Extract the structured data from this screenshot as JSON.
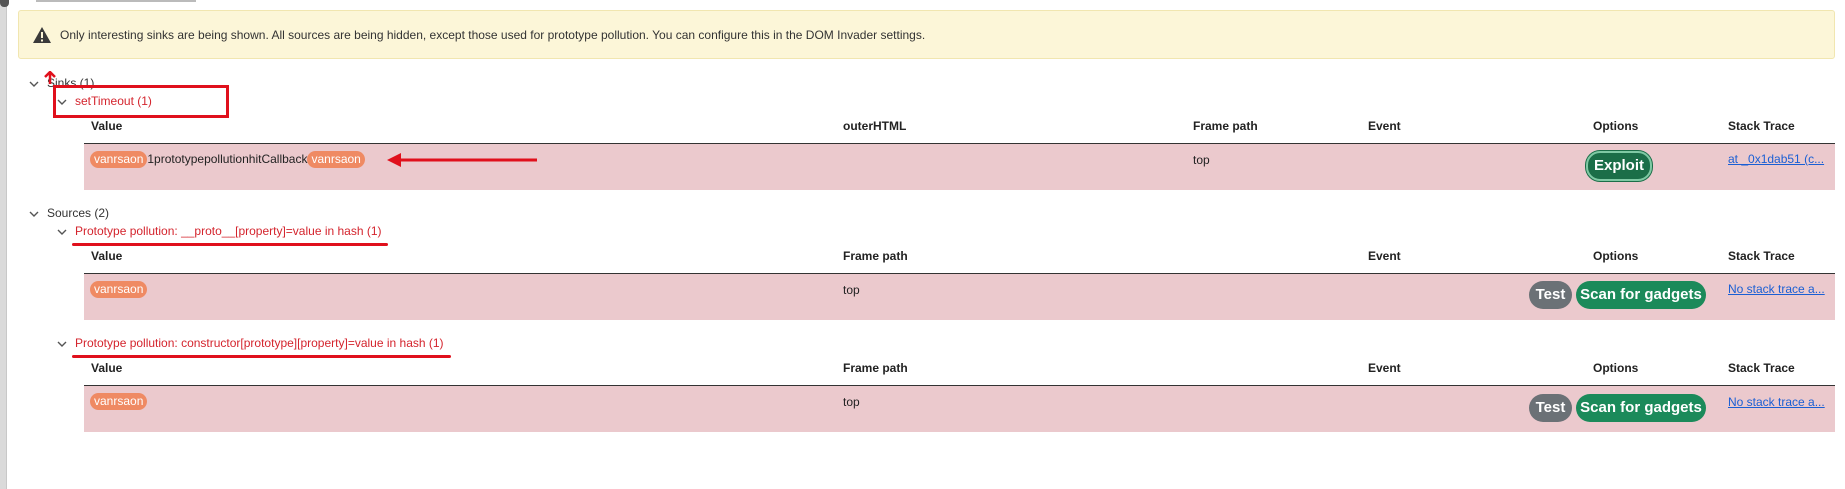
{
  "notice": {
    "text": "Only interesting sinks are being shown. All sources are being hidden, except those used for prototype pollution. You can configure this in the DOM Invader settings."
  },
  "sinks": {
    "label": "Sinks (1)",
    "groups": [
      {
        "label": "setTimeout (1)",
        "columns": {
          "value": "Value",
          "outer": "outerHTML",
          "frame": "Frame path",
          "event": "Event",
          "options": "Options",
          "stack": "Stack Trace"
        },
        "row": {
          "value_tag1": "vanrsaon",
          "value_text": "1prototypepollutionhitCallback",
          "value_tag2": "vanrsaon",
          "frame": "top",
          "exploit_label": "Exploit",
          "stack": "at _0x1dab51 (c..."
        }
      }
    ]
  },
  "sources": {
    "label": "Sources (2)",
    "groups": [
      {
        "label": "Prototype pollution: __proto__[property]=value in hash (1)",
        "columns": {
          "value": "Value",
          "frame": "Frame path",
          "event": "Event",
          "options": "Options",
          "stack": "Stack Trace"
        },
        "row": {
          "value_tag": "vanrsaon",
          "frame": "top",
          "test_label": "Test",
          "scan_label": "Scan for gadgets",
          "stack": "No stack trace a..."
        }
      },
      {
        "label": "Prototype pollution: constructor[prototype][property]=value in hash (1)",
        "columns": {
          "value": "Value",
          "frame": "Frame path",
          "event": "Event",
          "options": "Options",
          "stack": "Stack Trace"
        },
        "row": {
          "value_tag": "vanrsaon",
          "frame": "top",
          "test_label": "Test",
          "scan_label": "Scan for gadgets",
          "stack": "No stack trace a..."
        }
      }
    ]
  },
  "colors": {
    "row_bg": "#ebc9cd",
    "tag_bg": "#ef8a63",
    "scan_btn": "#1b8a5a",
    "test_btn": "#6b7176",
    "annotation_red": "#e0101c",
    "link": "#1a5fd4"
  }
}
